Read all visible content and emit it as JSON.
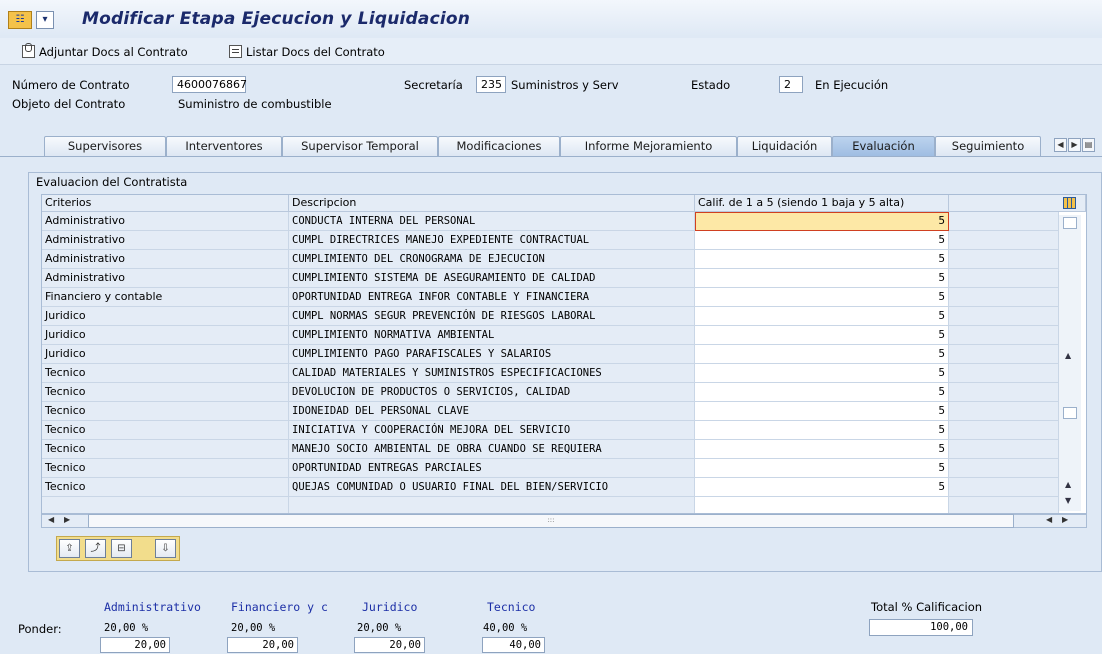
{
  "window": {
    "title": "Modificar Etapa Ejecucion y Liquidacion"
  },
  "toolbar": {
    "attach_label": "Adjuntar Docs al Contrato",
    "list_label": "Listar Docs del Contrato"
  },
  "header": {
    "contract_number_label": "Número de Contrato",
    "contract_number": "4600076867",
    "secretaria_label": "Secretaría",
    "secretaria_code": "235",
    "secretaria_name": "Suministros y Serv",
    "estado_label": "Estado",
    "estado_code": "2",
    "estado_name": "En Ejecución",
    "objeto_label": "Objeto del Contrato",
    "objeto_value": "Suministro de combustible"
  },
  "tabs": [
    {
      "label": "Supervisores"
    },
    {
      "label": "Interventores"
    },
    {
      "label": "Supervisor Temporal"
    },
    {
      "label": "Modificaciones"
    },
    {
      "label": "Informe Mejoramiento"
    },
    {
      "label": "Liquidación"
    },
    {
      "label": "Evaluación",
      "active": true
    },
    {
      "label": "Seguimiento"
    }
  ],
  "evaluation": {
    "group_title": "Evaluacion del Contratista",
    "columns": {
      "criterios": "Criterios",
      "descripcion": "Descripcion",
      "calificacion": "Calif. de 1 a 5 (siendo 1 baja y 5 alta)"
    },
    "rows": [
      {
        "criterio": "Administrativo",
        "descripcion": "CONDUCTA INTERNA DEL PERSONAL",
        "calif": "5"
      },
      {
        "criterio": "Administrativo",
        "descripcion": "CUMPL DIRECTRICES MANEJO EXPEDIENTE CONTRACTUAL",
        "calif": "5"
      },
      {
        "criterio": "Administrativo",
        "descripcion": "CUMPLIMIENTO DEL CRONOGRAMA DE EJECUCION",
        "calif": "5"
      },
      {
        "criterio": "Administrativo",
        "descripcion": "CUMPLIMIENTO SISTEMA DE ASEGURAMIENTO DE CALIDAD",
        "calif": "5"
      },
      {
        "criterio": "Financiero y contable",
        "descripcion": "OPORTUNIDAD ENTREGA INFOR CONTABLE Y FINANCIERA",
        "calif": "5"
      },
      {
        "criterio": "Juridico",
        "descripcion": "CUMPL NORMAS SEGUR PREVENCIÓN DE RIESGOS LABORAL",
        "calif": "5"
      },
      {
        "criterio": "Juridico",
        "descripcion": "CUMPLIMIENTO NORMATIVA AMBIENTAL",
        "calif": "5"
      },
      {
        "criterio": "Juridico",
        "descripcion": "CUMPLIMIENTO PAGO PARAFISCALES Y SALARIOS",
        "calif": "5"
      },
      {
        "criterio": "Tecnico",
        "descripcion": "CALIDAD MATERIALES Y SUMINISTROS ESPECIFICACIONES",
        "calif": "5"
      },
      {
        "criterio": "Tecnico",
        "descripcion": "DEVOLUCION DE PRODUCTOS O SERVICIOS, CALIDAD",
        "calif": "5"
      },
      {
        "criterio": "Tecnico",
        "descripcion": "IDONEIDAD DEL PERSONAL CLAVE",
        "calif": "5"
      },
      {
        "criterio": "Tecnico",
        "descripcion": "INICIATIVA Y COOPERACIÓN MEJORA DEL SERVICIO",
        "calif": "5"
      },
      {
        "criterio": "Tecnico",
        "descripcion": "MANEJO SOCIO AMBIENTAL DE OBRA CUANDO SE REQUIERA",
        "calif": "5"
      },
      {
        "criterio": "Tecnico",
        "descripcion": "OPORTUNIDAD ENTREGAS PARCIALES",
        "calif": "5"
      },
      {
        "criterio": "Tecnico",
        "descripcion": "QUEJAS COMUNIDAD O USUARIO FINAL DEL BIEN/SERVICIO",
        "calif": "5"
      }
    ],
    "hscroll_grip": ":::"
  },
  "summary": {
    "ponder_label": "Ponder:",
    "categories": [
      {
        "label": "Administrativo",
        "pct": "20,00 %",
        "value": "20,00"
      },
      {
        "label": "Financiero y c",
        "pct": "20,00 %",
        "value": "20,00"
      },
      {
        "label": "Juridico",
        "pct": "20,00 %",
        "value": "20,00"
      },
      {
        "label": "Tecnico",
        "pct": "40,00 %",
        "value": "40,00"
      }
    ],
    "total_label": "Total % Calificacion",
    "total_value": "100,00"
  },
  "icons": {
    "title_icon": "sap-screen-icon",
    "menu_icon": "menu-dropdown-icon",
    "attach_icon": "attach-document-icon",
    "list_icon": "list-documents-icon",
    "grid_settings_icon": "column-layout-icon",
    "table_buttons": [
      "insert-row-icon",
      "append-row-icon",
      "delete-row-icon",
      "copy-row-icon"
    ]
  },
  "colors": {
    "title": "#1b2a6b",
    "category_labels": "#1c2fa6",
    "active_tab": "#a9c5e8",
    "selected_cell": "#fde8a6"
  }
}
